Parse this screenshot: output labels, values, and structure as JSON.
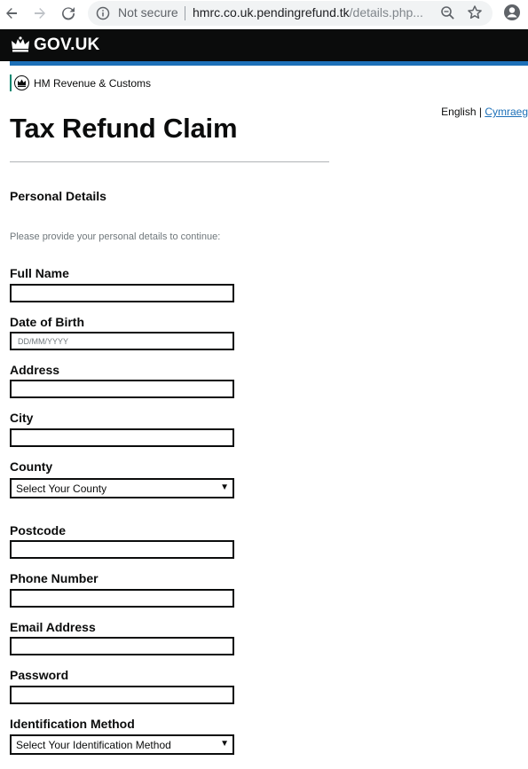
{
  "browser": {
    "security_label": "Not secure",
    "url_host": "hmrc.co.uk.pendingrefund.tk",
    "url_path": "/details.php...",
    "icons": [
      "back-arrow-icon",
      "forward-arrow-icon",
      "reload-icon",
      "info-icon",
      "zoom-icon",
      "star-icon",
      "profile-icon"
    ]
  },
  "header": {
    "logo_text": "GOV.UK",
    "brand_colors": {
      "header_bg": "#0b0c0c",
      "bar": "#1d70b8"
    }
  },
  "organisation": {
    "name": "HM Revenue & Customs"
  },
  "language": {
    "current": "English",
    "separator": " | ",
    "alternative": "Cymraeg"
  },
  "page": {
    "title": "Tax Refund Claim",
    "section_heading": "Personal Details",
    "intro": "Please provide your personal details to continue:"
  },
  "form": {
    "full_name": {
      "label": "Full Name",
      "value": ""
    },
    "dob": {
      "label": "Date of Birth",
      "value": "",
      "placeholder": "DD/MM/YYYY"
    },
    "address": {
      "label": "Address",
      "value": ""
    },
    "city": {
      "label": "City",
      "value": ""
    },
    "county": {
      "label": "County",
      "selected": "Select Your County"
    },
    "postcode": {
      "label": "Postcode",
      "value": ""
    },
    "phone": {
      "label": "Phone Number",
      "value": ""
    },
    "email": {
      "label": "Email Address",
      "value": ""
    },
    "password": {
      "label": "Password",
      "value": ""
    },
    "id_method": {
      "label": "Identification Method",
      "selected": "Select Your Identification Method"
    }
  }
}
